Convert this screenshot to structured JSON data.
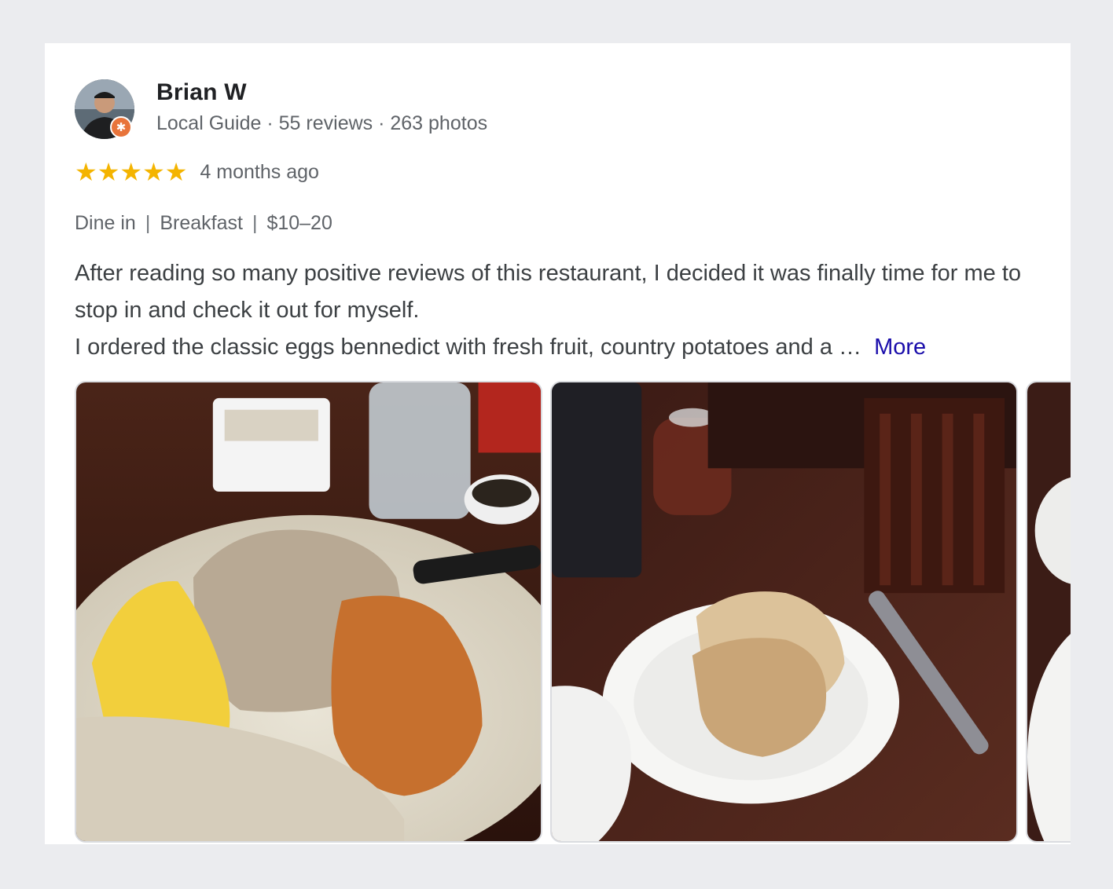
{
  "reviewer": {
    "name": "Brian W",
    "level": "Local Guide",
    "reviews": "55 reviews",
    "photos": "263 photos",
    "meta_sep": " · "
  },
  "rating": {
    "stars": 5,
    "star_glyph": "★",
    "time_ago": "4 months ago",
    "star_color": "#f4b400"
  },
  "tags": [
    "Dine in",
    "Breakfast",
    "$10–20"
  ],
  "tag_separator": "|",
  "review": {
    "line1": "After reading so many positive reviews of this restaurant, I decided it was finally time for me to stop in and check it out for myself.",
    "line2": "I ordered the classic eggs bennedict with fresh fruit, country potatoes and a …",
    "more_label": "More"
  },
  "photos": [
    {
      "icon": "breakfast-plate-photo"
    },
    {
      "icon": "toast-plate-photo"
    },
    {
      "icon": "partial-plate-photo"
    }
  ],
  "colors": {
    "link": "#1a0dab",
    "badge": "#e8743b",
    "page_bg": "#ebecef"
  }
}
